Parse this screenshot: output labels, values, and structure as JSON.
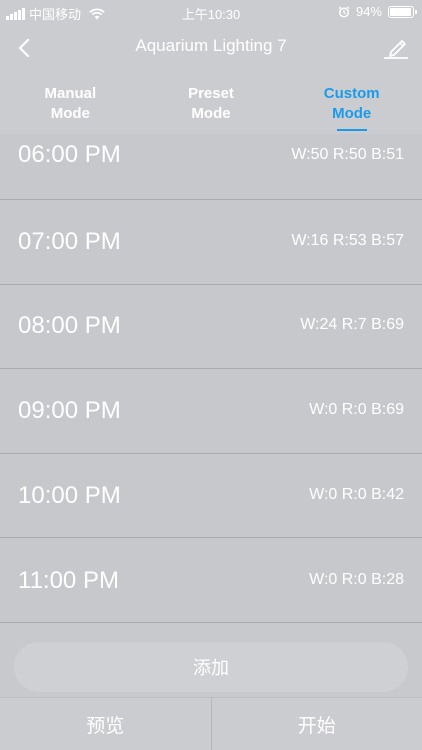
{
  "status_bar": {
    "carrier": "中国移动",
    "time": "上午10:30",
    "battery_percent": "94%",
    "battery_level": 0.94,
    "icons": [
      "signal-icon",
      "wifi-icon",
      "alarm-icon",
      "battery-icon"
    ]
  },
  "navbar": {
    "title": "Aquarium Lighting 7",
    "back_icon": "chevron-left-icon",
    "edit_icon": "pencil-icon"
  },
  "tabs": [
    {
      "line1": "Manual",
      "line2": "Mode",
      "active": false
    },
    {
      "line1": "Preset",
      "line2": "Mode",
      "active": false
    },
    {
      "line1": "Custom",
      "line2": "Mode",
      "active": true
    }
  ],
  "schedule": [
    {
      "time": "06:00 PM",
      "values": "W:50 R:50 B:51"
    },
    {
      "time": "07:00 PM",
      "values": "W:16 R:53 B:57"
    },
    {
      "time": "08:00 PM",
      "values": "W:24 R:7 B:69"
    },
    {
      "time": "09:00 PM",
      "values": "W:0 R:0 B:69"
    },
    {
      "time": "10:00 PM",
      "values": "W:0 R:0 B:42"
    },
    {
      "time": "11:00 PM",
      "values": "W:0 R:0 B:28"
    }
  ],
  "add_button": "添加",
  "bottom_bar": {
    "preview": "预览",
    "start": "开始"
  },
  "colors": {
    "accent": "#1a9bea",
    "background": "#c8c9cc"
  }
}
